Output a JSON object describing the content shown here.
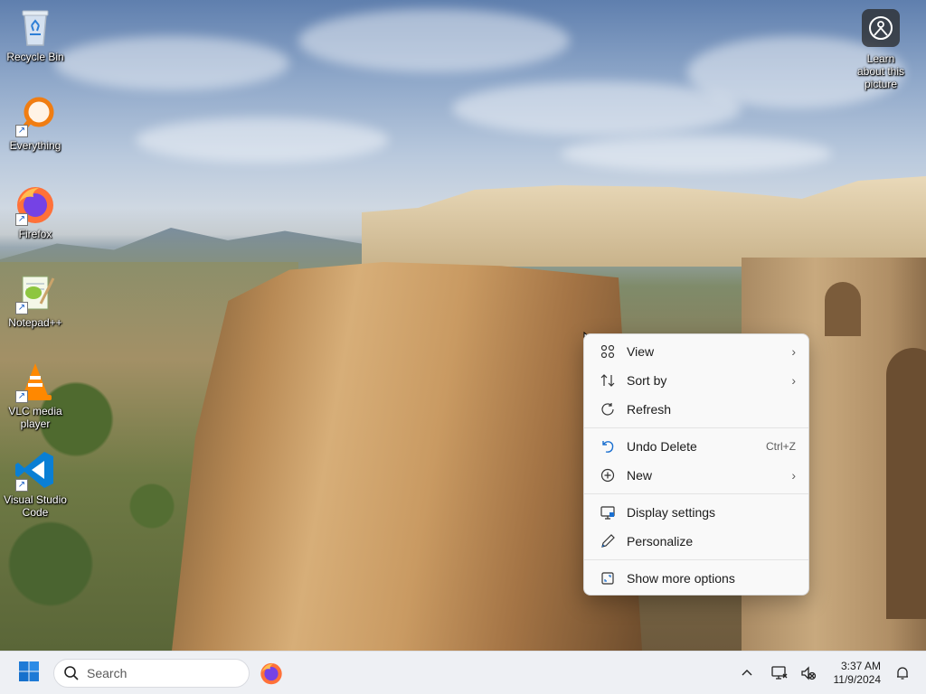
{
  "desktop": {
    "icons": [
      {
        "label": "Recycle Bin",
        "icon": "recycle-bin-icon"
      },
      {
        "label": "Everything",
        "icon": "everything-search-icon"
      },
      {
        "label": "Firefox",
        "icon": "firefox-icon"
      },
      {
        "label": "Notepad++",
        "icon": "notepad-plus-plus-icon"
      },
      {
        "label": "VLC media player",
        "icon": "vlc-icon"
      },
      {
        "label": "Visual Studio Code",
        "icon": "vscode-icon"
      }
    ],
    "learn_about": {
      "label": "Learn about this picture",
      "icon": "camera-info-icon"
    }
  },
  "context_menu": {
    "items": [
      {
        "label": "View",
        "icon": "grid-icon",
        "submenu": true
      },
      {
        "label": "Sort by",
        "icon": "sort-icon",
        "submenu": true
      },
      {
        "label": "Refresh",
        "icon": "refresh-icon"
      },
      {
        "label": "Undo Delete",
        "icon": "undo-icon",
        "shortcut": "Ctrl+Z"
      },
      {
        "label": "New",
        "icon": "plus-circle-icon",
        "submenu": true
      },
      {
        "label": "Display settings",
        "icon": "display-icon"
      },
      {
        "label": "Personalize",
        "icon": "pen-icon"
      },
      {
        "label": "Show more options",
        "icon": "expand-icon"
      }
    ],
    "arrow": "›"
  },
  "taskbar": {
    "search_placeholder": "Search",
    "pinned": [
      {
        "name": "Firefox",
        "icon": "firefox-icon"
      }
    ],
    "tray_icons": [
      "chevron-up-icon",
      "network-icon",
      "volume-muted-icon"
    ],
    "time": "3:37 AM",
    "date": "11/9/2024",
    "notification_icon": "bell-icon"
  },
  "colors": {
    "accent": "#0067c0",
    "menu_bg": "#f9f9f9",
    "taskbar_bg": "#eef0f4"
  }
}
